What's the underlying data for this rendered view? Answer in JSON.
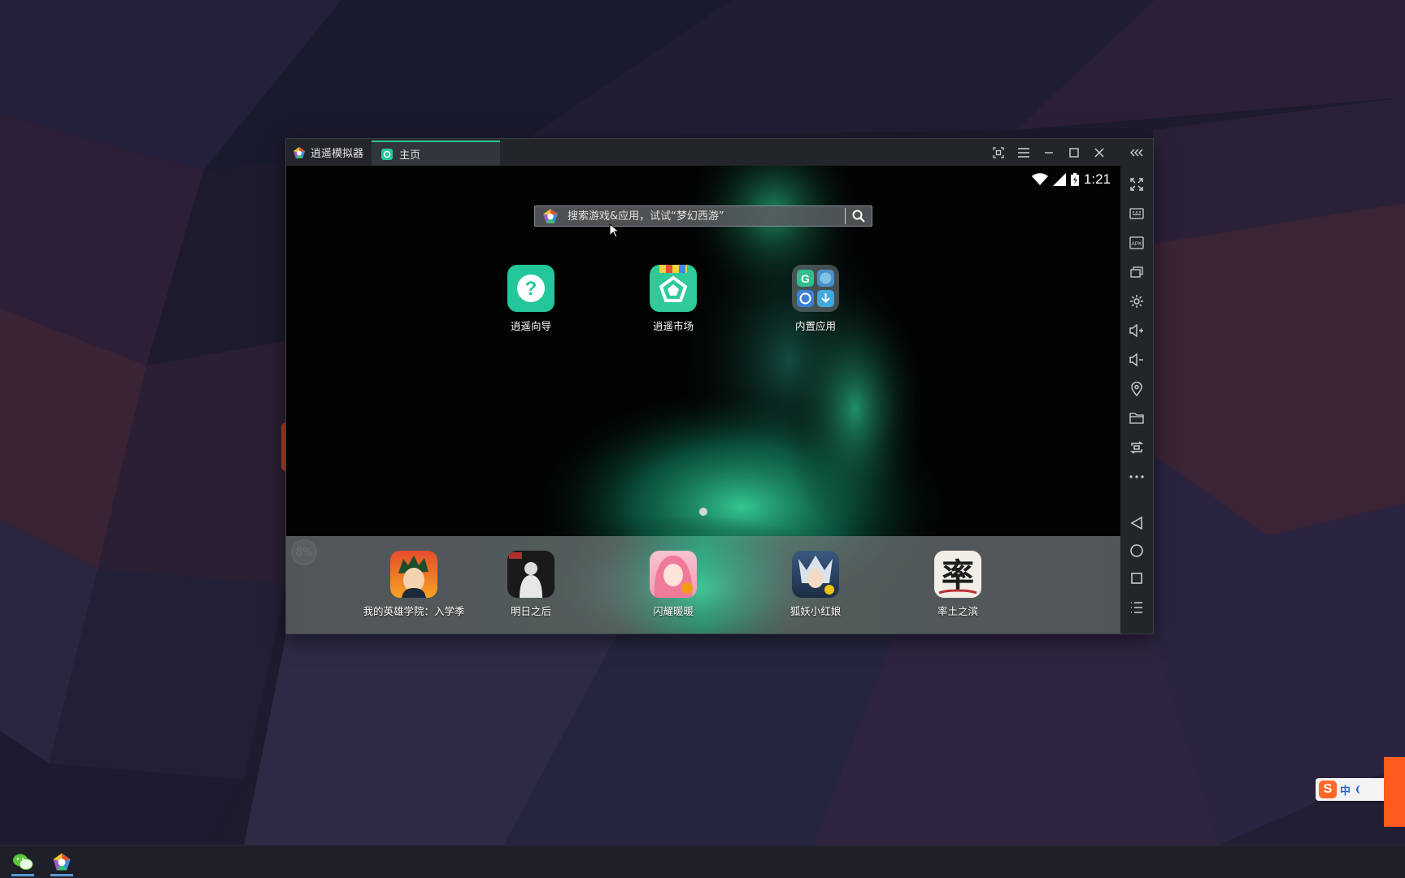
{
  "emulator": {
    "app_name": "逍遥模拟器",
    "tab_label": "主页",
    "status_time": "1:21",
    "search": {
      "placeholder": "搜索游戏&应用，试试“梦幻西游”"
    },
    "progress_badge": "8%",
    "desktop_apps": [
      {
        "label": "逍遥向导",
        "icon": "help-icon"
      },
      {
        "label": "逍遥市场",
        "icon": "market-icon"
      },
      {
        "label": "内置应用",
        "icon": "folder-icon"
      }
    ],
    "dock_apps": [
      {
        "label": "我的英雄学院：入学季"
      },
      {
        "label": "明日之后"
      },
      {
        "label": "闪耀暖暖"
      },
      {
        "label": "狐妖小红娘"
      },
      {
        "label": "率土之滨"
      }
    ],
    "sidebar_items": [
      "fullscreen-icon",
      "keyboard-icon",
      "apk-icon",
      "multi-instance-icon",
      "settings-icon",
      "volume-up-icon",
      "volume-down-icon",
      "location-icon",
      "folder-icon",
      "rotate-icon",
      "more-icon",
      "back-icon",
      "home-icon",
      "recents-icon",
      "menu-icon"
    ]
  },
  "ime": {
    "label": "中"
  },
  "taskbar": {
    "apps": [
      "wechat-icon",
      "emulator-icon"
    ]
  },
  "colors": {
    "accent": "#29c79a",
    "titlebar": "#22262a",
    "desktop": "#1c1a2c"
  }
}
